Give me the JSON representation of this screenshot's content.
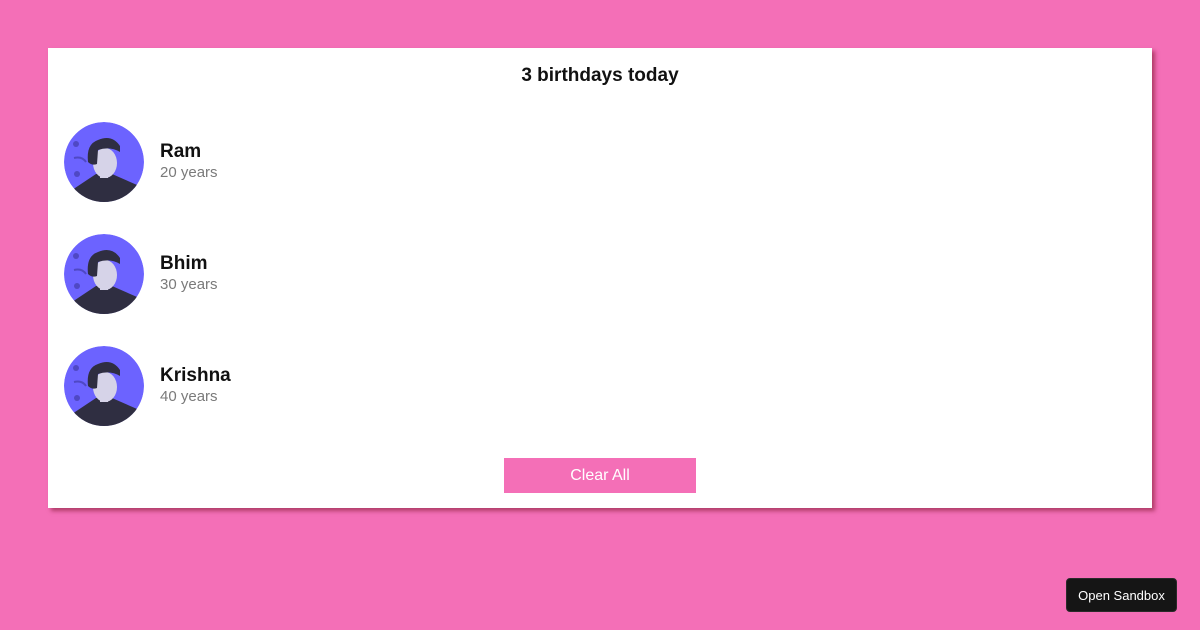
{
  "card": {
    "title": "3 birthdays today",
    "people": [
      {
        "name": "Ram",
        "age": "20 years",
        "avatar": "person-avatar-icon"
      },
      {
        "name": "Bhim",
        "age": "30 years",
        "avatar": "person-avatar-icon"
      },
      {
        "name": "Krishna",
        "age": "40 years",
        "avatar": "person-avatar-icon"
      }
    ],
    "clear_label": "Clear All"
  },
  "sandbox": {
    "label": "Open Sandbox"
  },
  "colors": {
    "background": "#f46fb7",
    "card": "#ffffff",
    "button": "#f46fb7",
    "avatar_bg": "#6c63ff",
    "avatar_shirt": "#2f2e41",
    "sandbox_button": "#151515"
  }
}
